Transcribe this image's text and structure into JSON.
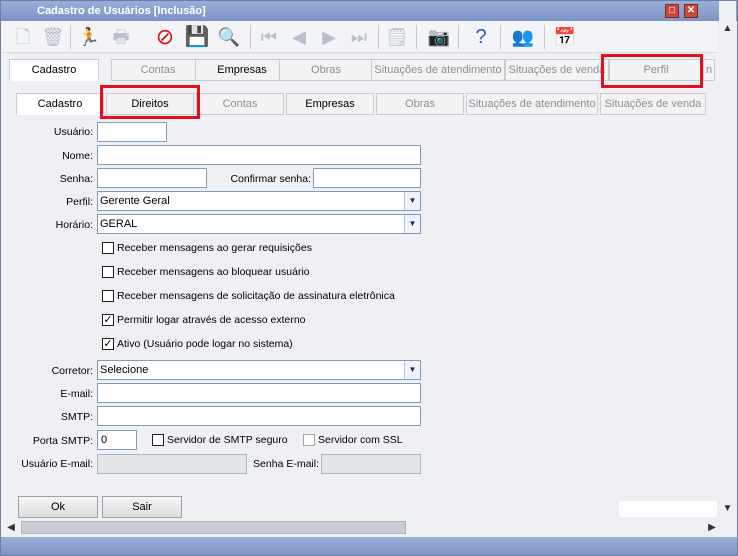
{
  "window": {
    "title": "Cadastro de Usuários [Inclusão]"
  },
  "toolbar": {
    "icons": [
      "new-document-icon",
      "trash-icon",
      "runner-icon",
      "printer-icon",
      "no-entry-icon",
      "save-icon",
      "magnifier-icon",
      "first-record-icon",
      "previous-record-icon",
      "next-record-icon",
      "last-record-icon",
      "notes-icon",
      "camera-icon",
      "help-icon",
      "users-icon",
      "calendar-user-icon"
    ]
  },
  "tabs_top": [
    "Cadastro",
    "Contas",
    "Empresas",
    "Obras",
    "Situações de atendimento",
    "Situações de venda",
    "Perfil",
    "n"
  ],
  "tabs_sub": [
    "Cadastro",
    "Direitos",
    "Contas",
    "Empresas",
    "Obras",
    "Situações de atendimento",
    "Situações de venda"
  ],
  "form": {
    "usuario_label": "Usuário:",
    "usuario_value": "",
    "nome_label": "Nome:",
    "nome_value": "",
    "senha_label": "Senha:",
    "confirmar_label": "Confirmar senha:",
    "perfil_label": "Perfil:",
    "perfil_value": "Gerente Geral",
    "horario_label": "Horário:",
    "horario_value": "GERAL",
    "chk1": "Receber mensagens ao gerar requisições",
    "chk2": "Receber mensagens ao bloquear usuário",
    "chk3": "Receber mensagens de solicitação de assinatura eletrônica",
    "chk4": "Permitir logar através de acesso externo",
    "chk5": "Ativo (Usuário pode logar no sistema)",
    "corretor_label": "Corretor:",
    "corretor_value": "Selecione",
    "email_label": "E-mail:",
    "smtp_label": "SMTP:",
    "porta_label": "Porta SMTP:",
    "porta_value": "0",
    "smtp_seguro": "Servidor de SMTP seguro",
    "ssl": "Servidor com SSL",
    "usuario_email_label": "Usuário E-mail:",
    "senha_email_label": "Senha E-mail:"
  },
  "buttons": {
    "ok": "Ok",
    "sair": "Sair"
  },
  "checks": {
    "chk1": false,
    "chk2": false,
    "chk3": false,
    "chk4": true,
    "chk5": true,
    "smtp_seguro": false,
    "ssl": false
  },
  "colors": {
    "highlight": "#e3101a",
    "title_bar": "#7d93c6"
  }
}
